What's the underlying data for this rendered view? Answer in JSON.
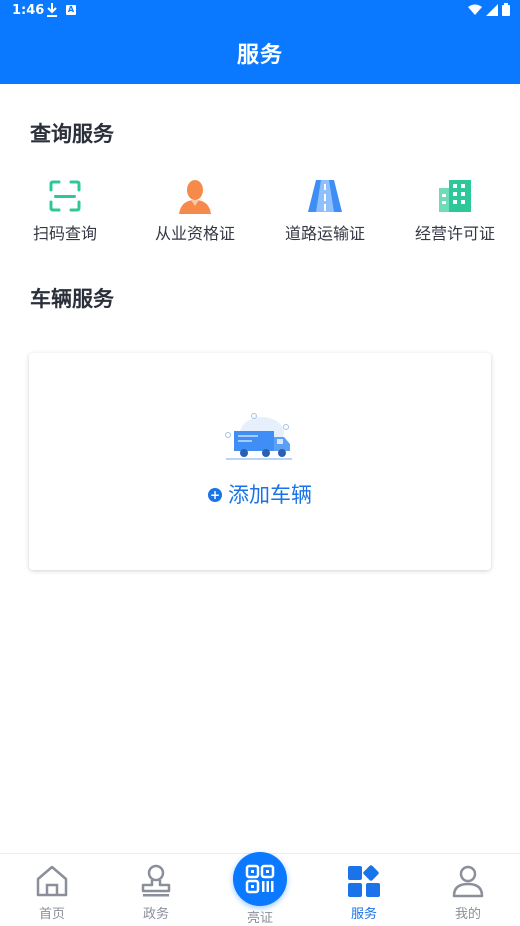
{
  "status_bar": {
    "time": "1:46"
  },
  "app_bar": {
    "title": "服务"
  },
  "query_section": {
    "title": "查询服务",
    "items": [
      {
        "label": "扫码查询",
        "icon": "scan-icon"
      },
      {
        "label": "从业资格证",
        "icon": "person-icon"
      },
      {
        "label": "道路运输证",
        "icon": "road-icon"
      },
      {
        "label": "经营许可证",
        "icon": "building-icon"
      }
    ]
  },
  "vehicle_section": {
    "title": "车辆服务",
    "add_label": "添加车辆",
    "add_icon": "plus-circle-icon",
    "illustration": "truck-icon"
  },
  "tab_bar": {
    "tabs": [
      {
        "label": "首页",
        "icon": "home-icon"
      },
      {
        "label": "政务",
        "icon": "stamp-icon"
      },
      {
        "label": "亮证",
        "icon": "qrcode-icon"
      },
      {
        "label": "服务",
        "icon": "grid-icon",
        "active": true
      },
      {
        "label": "我的",
        "icon": "user-icon"
      }
    ]
  },
  "colors": {
    "primary": "#0a78ff",
    "link": "#1a73e8",
    "teal": "#2ec79a",
    "orange": "#f58a4a"
  }
}
